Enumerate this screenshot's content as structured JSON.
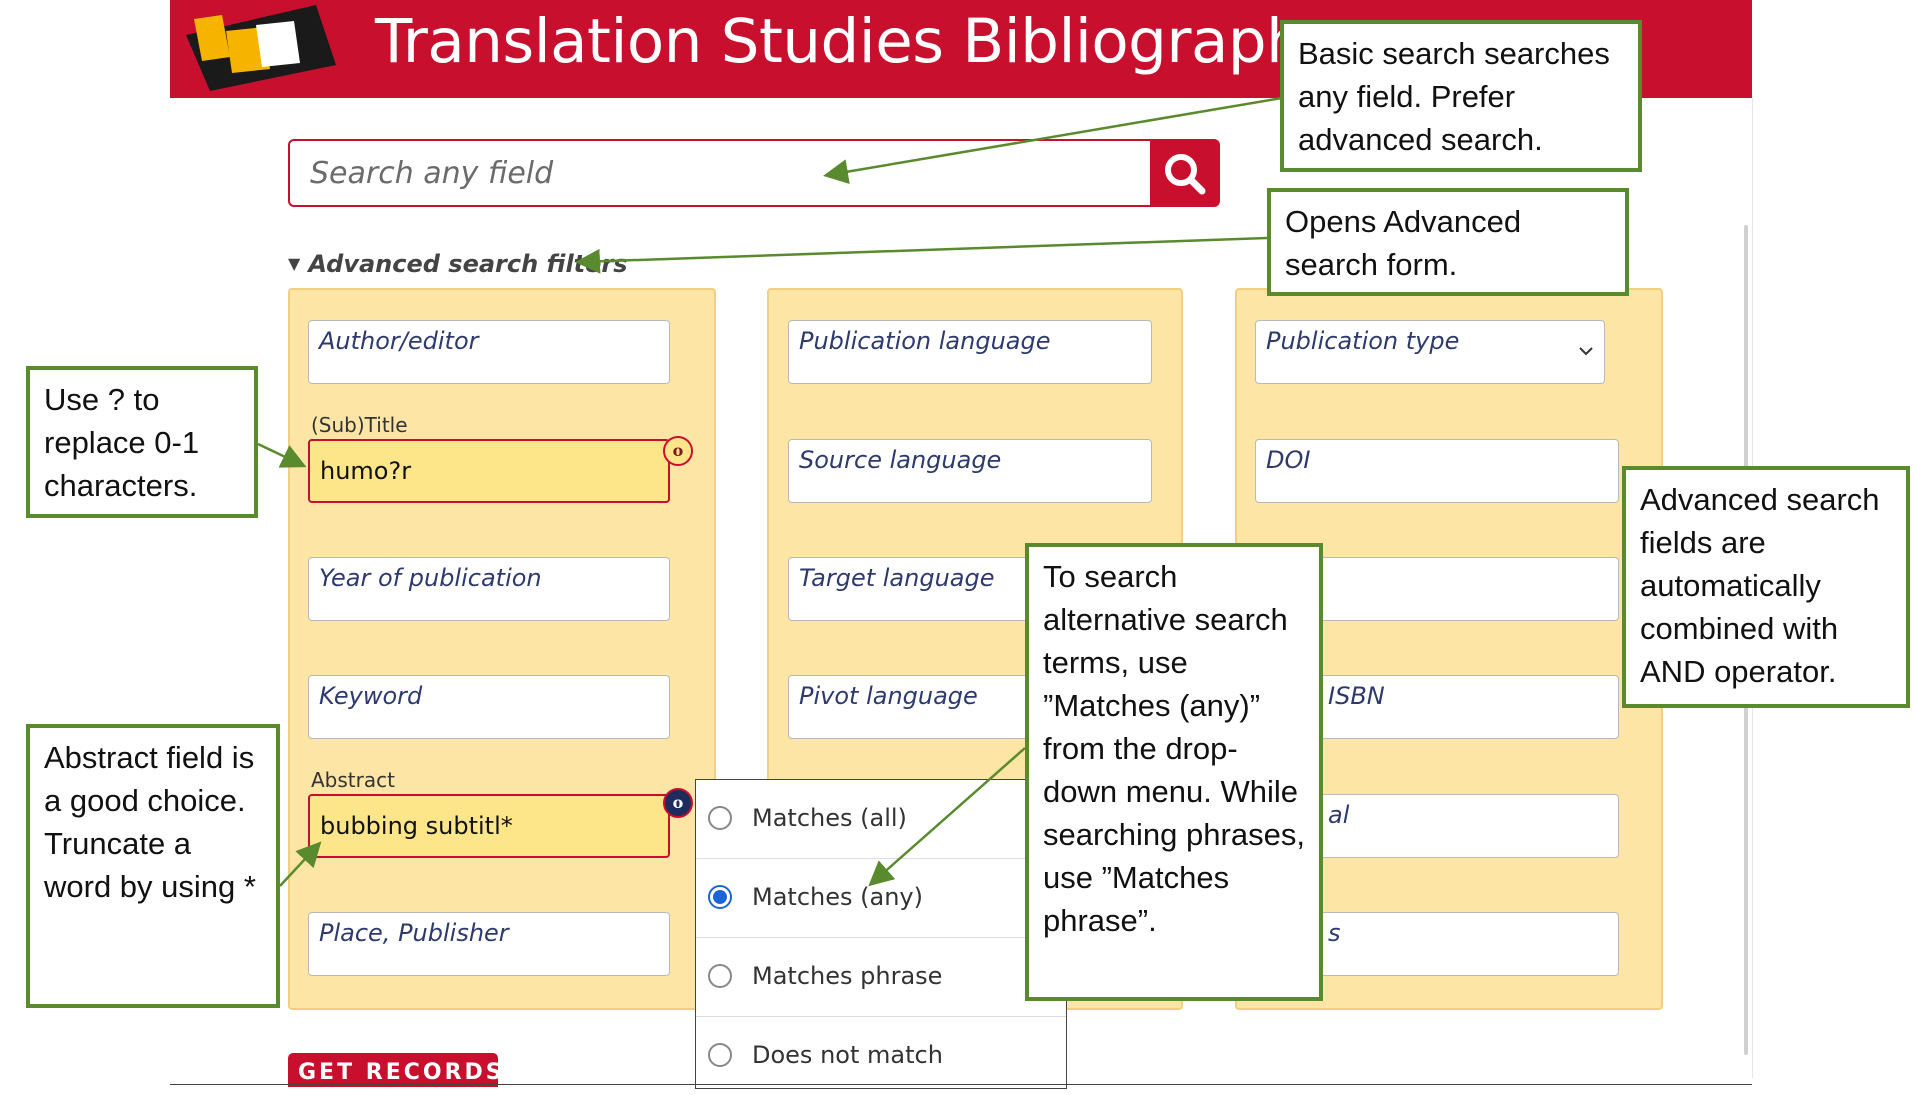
{
  "header": {
    "title": "Translation Studies Bibliography",
    "brand_color": "#c8102e"
  },
  "search": {
    "placeholder": "Search any field",
    "button_icon": "search-icon"
  },
  "advanced_toggle": {
    "label": "Advanced search filters",
    "icon": "triangle-down-icon"
  },
  "columns": [
    {
      "fields": [
        {
          "label": "",
          "value": "",
          "placeholder": "Author/editor"
        },
        {
          "label": "(Sub)Title",
          "value": "humo?r",
          "placeholder": "",
          "operator_badge": "o"
        },
        {
          "label": "",
          "value": "",
          "placeholder": "Year of publication"
        },
        {
          "label": "",
          "value": "",
          "placeholder": "Keyword"
        },
        {
          "label": "Abstract",
          "value": "bubbing subtitl*",
          "placeholder": "",
          "operator_badge": "o"
        },
        {
          "label": "",
          "value": "",
          "placeholder": "Place, Publisher"
        }
      ]
    },
    {
      "fields": [
        {
          "placeholder": "Publication language"
        },
        {
          "placeholder": "Source language"
        },
        {
          "placeholder": "Target language"
        },
        {
          "placeholder": "Pivot language"
        }
      ]
    },
    {
      "fields": [
        {
          "placeholder": "Publication type",
          "icon": "chevron-down-icon"
        },
        {
          "placeholder": "DOI"
        },
        {
          "placeholder": ""
        },
        {
          "placeholder": "ISBN"
        },
        {
          "placeholder": "al"
        },
        {
          "placeholder": "s"
        }
      ]
    }
  ],
  "match_menu": {
    "options": [
      "Matches (all)",
      "Matches (any)",
      "Matches phrase",
      "Does not match"
    ],
    "selected": "Matches (any)"
  },
  "get_records": {
    "label": "GET RECORDS"
  },
  "callouts": {
    "basic_search": "Basic search searches any field. Prefer advanced search.",
    "opens_advanced": "Opens Advanced search form.",
    "wildcard": "Use ? to replace 0-1 characters.",
    "abstract": "Abstract field is a good choice. Truncate a word by using *",
    "alternatives": "To search alternative search terms, use ”Matches (any)” from the drop-down menu. While searching phrases, use ”Matches phrase”.",
    "and_operator": "Advanced search fields are automatically combined with AND operator."
  },
  "colors": {
    "callout_border": "#5a8a2e",
    "panel_bg": "#fde5a6",
    "filled_field_bg": "#fde68a",
    "radio_selected": "#1a66d6"
  }
}
